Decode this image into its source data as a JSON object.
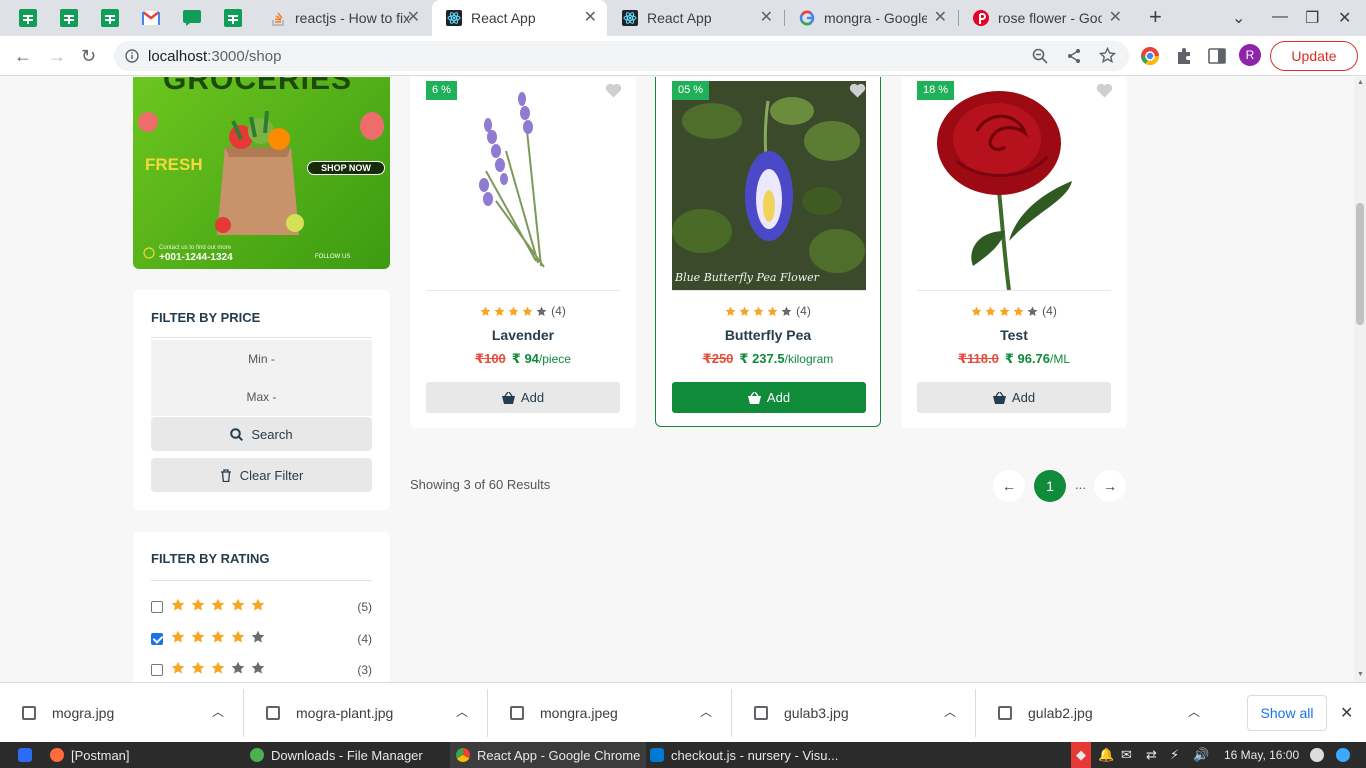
{
  "browser": {
    "tabs": [
      {
        "title": "reactjs - How to fix"
      },
      {
        "title": "React App"
      },
      {
        "title": "React App"
      },
      {
        "title": "mongra - Google S"
      },
      {
        "title": "rose flower - Goog"
      }
    ],
    "url_host": "localhost",
    "url_path": ":3000/shop",
    "profile_initial": "R",
    "update_label": "Update"
  },
  "banner": {
    "heading": "GROCERIES",
    "fresh": "FRESH",
    "shop_now": "SHOP NOW",
    "contact": "Contact us to find out more",
    "phone": "+001-1244-1324",
    "follow": "FOLLOW US"
  },
  "filter_price": {
    "title": "FILTER BY PRICE",
    "min_placeholder": "Min -",
    "max_placeholder": "Max -",
    "search_label": "Search",
    "clear_label": "Clear Filter"
  },
  "filter_rating": {
    "title": "FILTER BY RATING",
    "rows": [
      {
        "stars": 5,
        "checked": false,
        "count": "(5)"
      },
      {
        "stars": 4,
        "checked": true,
        "count": "(4)"
      },
      {
        "stars": 3,
        "checked": false,
        "count": "(3)"
      }
    ]
  },
  "products": [
    {
      "badge": "6 %",
      "name": "Lavender",
      "rating": 4,
      "rating_count": "(4)",
      "old_price": "₹100",
      "new_price": "₹ 94",
      "unit": "/piece",
      "add_label": "Add"
    },
    {
      "badge": "05 %",
      "name": "Butterfly Pea",
      "rating": 4,
      "rating_count": "(4)",
      "old_price": "₹250",
      "new_price": "₹ 237.5",
      "unit": "/kilogram",
      "add_label": "Add",
      "image_caption": "Blue Butterfly Pea Flower"
    },
    {
      "badge": "18 %",
      "name": "Test",
      "rating": 4,
      "rating_count": "(4)",
      "old_price": "₹118.0",
      "new_price": "₹ 96.76",
      "unit": "/ML",
      "add_label": "Add"
    }
  ],
  "results": {
    "showing": "Showing 3 of 60 Results",
    "current_page": "1",
    "ellipsis": "...",
    "prev_icon": "←",
    "next_icon": "→"
  },
  "downloads": {
    "files": [
      "mogra.jpg",
      "mogra-plant.jpg",
      "mongra.jpeg",
      "gulab3.jpg",
      "gulab2.jpg"
    ],
    "show_all": "Show all"
  },
  "taskbar": {
    "apps": [
      "[Postman]",
      "Downloads - File Manager",
      "React App - Google Chrome",
      "checkout.js - nursery - Visu..."
    ],
    "clock": "16 May, 16:00"
  },
  "colors": {
    "brand_green": "#0f8b3a",
    "badge_green": "#21b05a",
    "star": "#f5a623",
    "old_price_red": "#e74c3c"
  }
}
